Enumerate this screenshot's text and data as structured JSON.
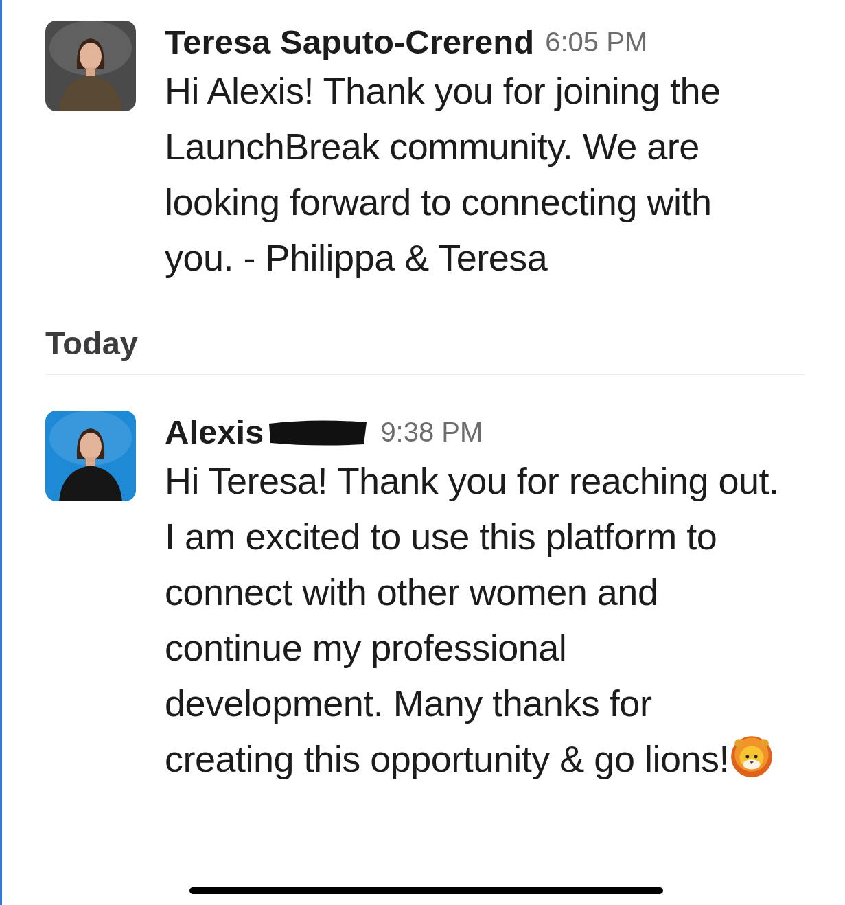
{
  "messages": [
    {
      "author": "Teresa Saputo-Crerend",
      "author_redacted": false,
      "time": "6:05 PM",
      "text": "Hi Alexis! Thank you for joining the LaunchBreak community. We are looking forward to connecting with you. - Philippa & Teresa",
      "emoji": false
    },
    {
      "divider": "Today"
    },
    {
      "author": "Alexis",
      "author_redacted": true,
      "time": "9:38 PM",
      "text": "Hi Teresa! Thank you for reaching out. I am excited to use this platform to connect with other women and continue my professional development. Many thanks for creating this opportunity & go lions!",
      "emoji": true
    }
  ]
}
